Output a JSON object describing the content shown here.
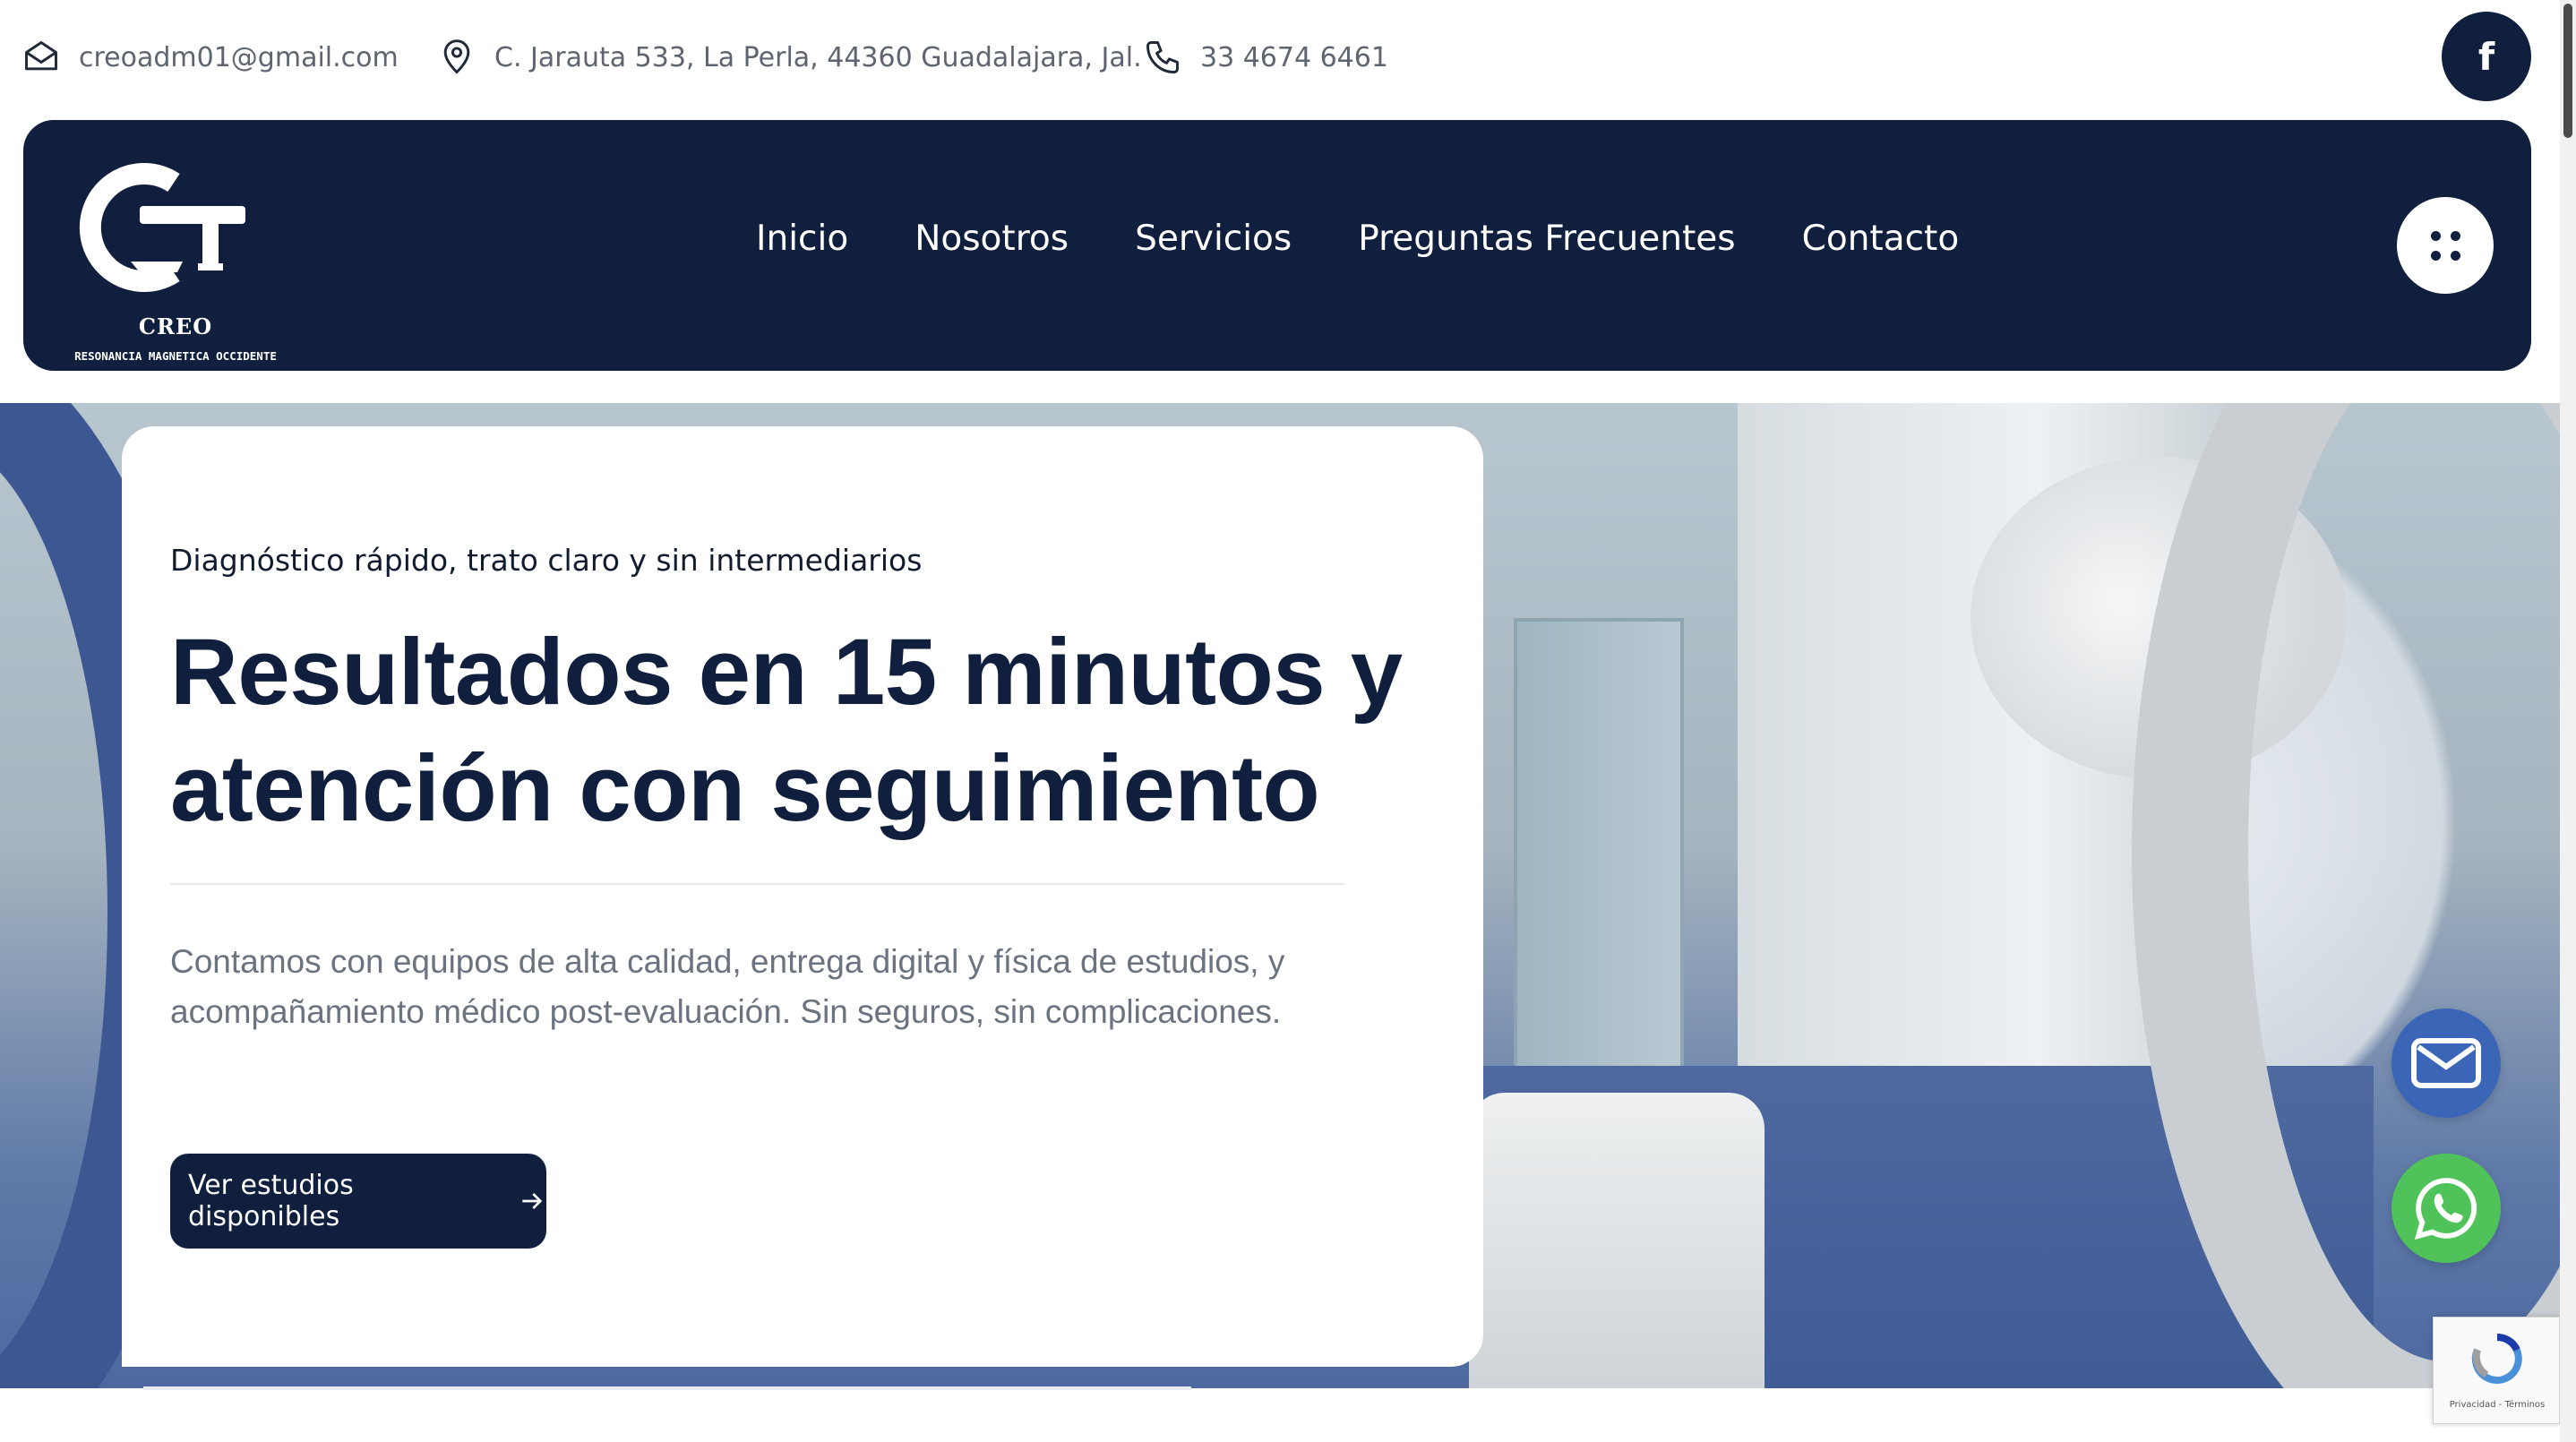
{
  "topbar": {
    "email": "creoadm01@gmail.com",
    "address": "C. Jarauta 533, La Perla, 44360 Guadalajara, Jal.",
    "phone": "33 4674 6461",
    "social_icon": "facebook-icon"
  },
  "header": {
    "logo": {
      "brand": "CREO",
      "tagline": "RESONANCIA MAGNETICA OCCIDENTE"
    },
    "nav": [
      {
        "label": "Inicio"
      },
      {
        "label": "Nosotros"
      },
      {
        "label": "Servicios"
      },
      {
        "label": "Preguntas Frecuentes"
      },
      {
        "label": "Contacto"
      }
    ],
    "menu_icon": "dots-grid-icon"
  },
  "hero": {
    "eyebrow": "Diagnóstico rápido, trato claro y sin intermediarios",
    "title": "Resultados en 15 minutos y atención con seguimiento",
    "description": "Contamos con equipos de alta calidad, entrega digital y física de estudios, y acompañamiento médico post-evaluación. Sin seguros, sin complicaciones.",
    "cta_label": "Ver estudios disponibles"
  },
  "floating": {
    "mail_icon": "envelope-icon",
    "whatsapp_icon": "whatsapp-icon"
  },
  "recaptcha": {
    "text": "Privacidad - Términos"
  },
  "colors": {
    "navy": "#0f1f3d",
    "mail_blue": "#3b66b8",
    "whatsapp_green": "#4fc35a",
    "muted_text": "#6b7280"
  }
}
